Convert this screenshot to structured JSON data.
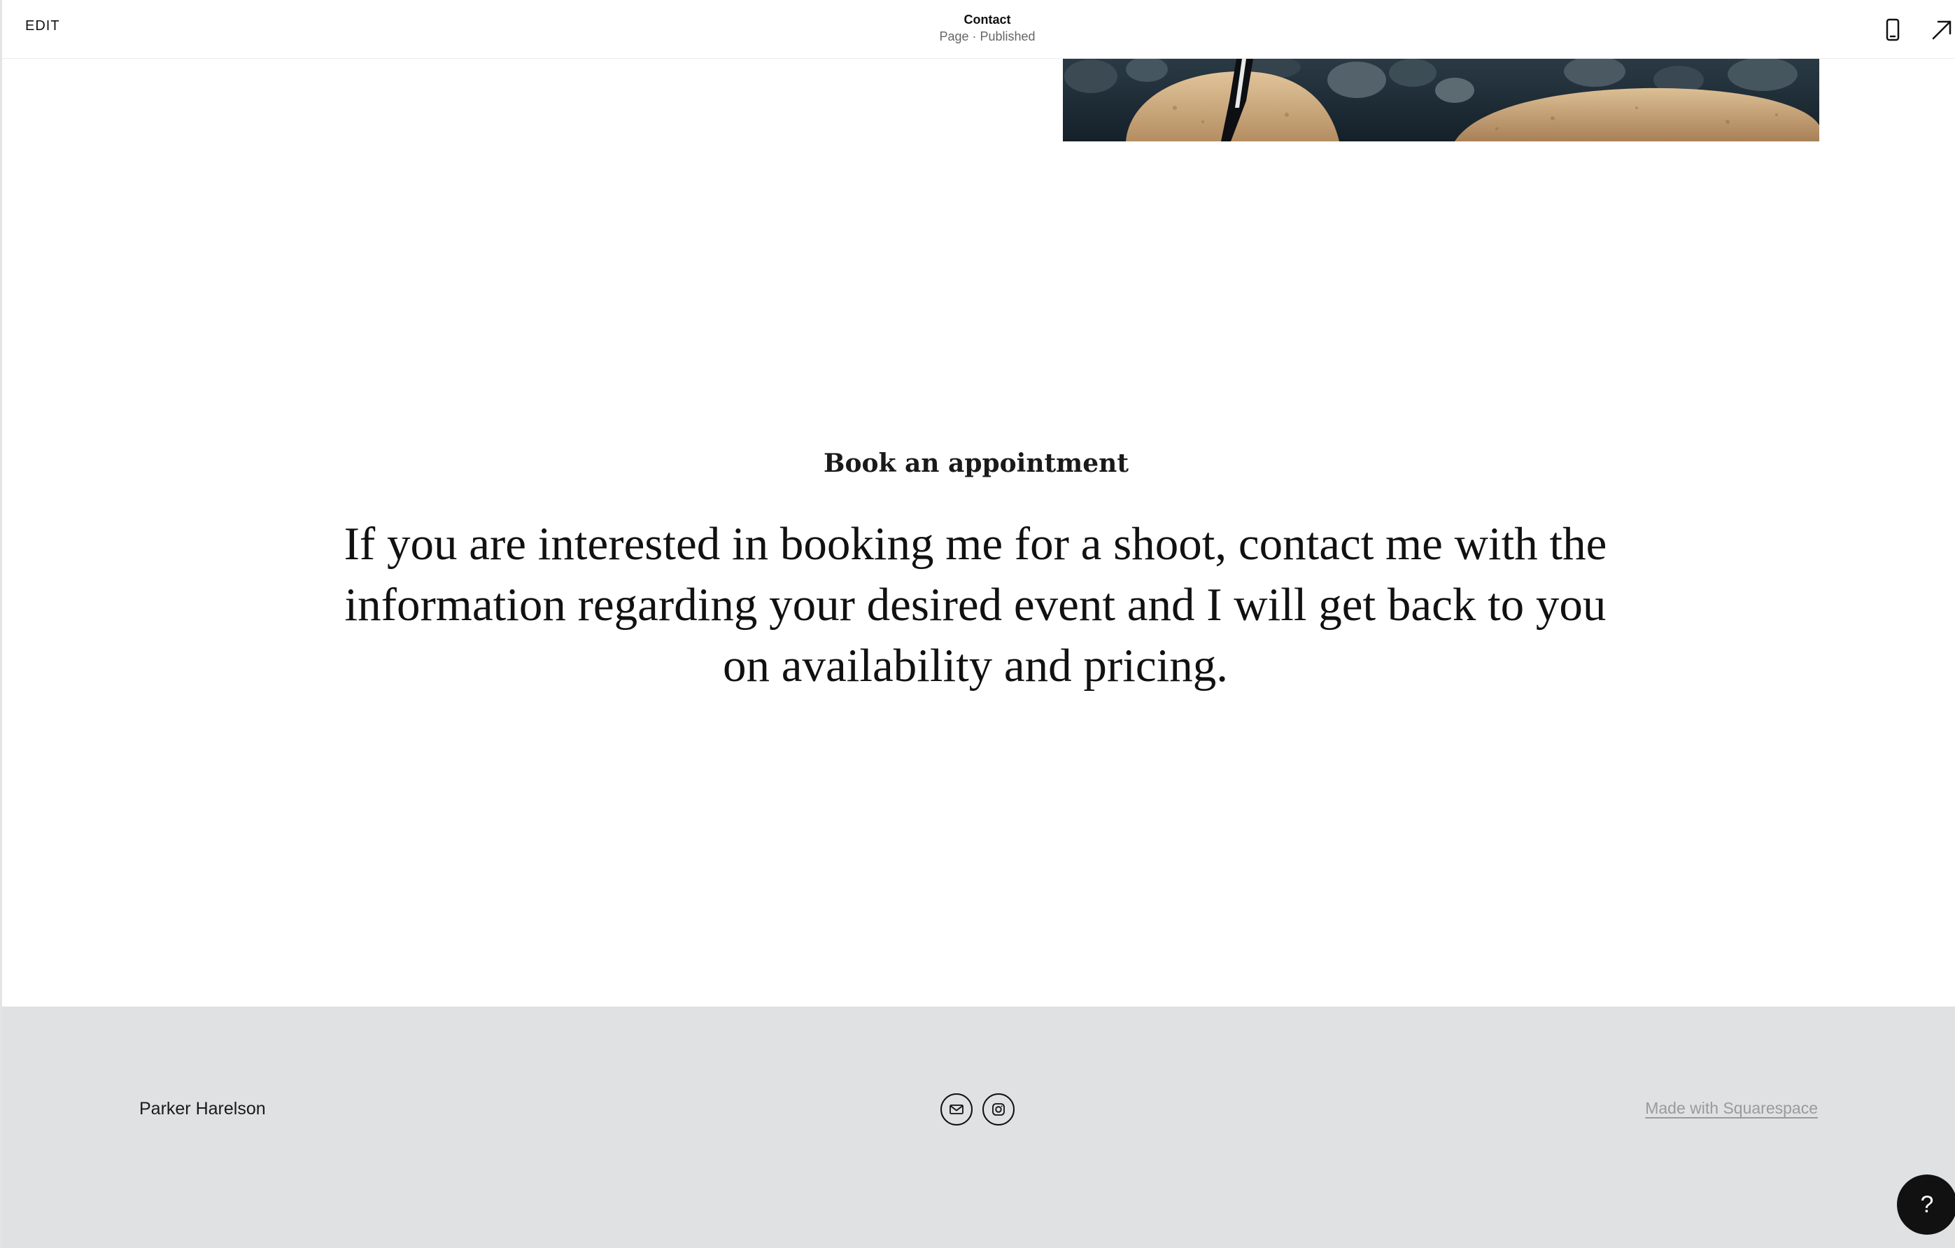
{
  "topbar": {
    "edit_label": "EDIT",
    "page_title": "Contact",
    "page_status": "Page · Published",
    "mobile_icon": "mobile-phone-icon",
    "open_icon": "arrow-up-right-icon"
  },
  "hero_image": {
    "description_icon": "photo-image"
  },
  "booking": {
    "heading": "Book an appointment",
    "body": "If you are interested in booking me for a shoot, contact me with the information regarding your desired event and I will get back to you on availability and pricing."
  },
  "footer": {
    "name": "Parker Harelson",
    "social_icons": [
      "email-icon",
      "instagram-icon"
    ],
    "made_with": "Made with Squarespace",
    "background": "#e0e1e3"
  },
  "help": {
    "label": "?"
  }
}
